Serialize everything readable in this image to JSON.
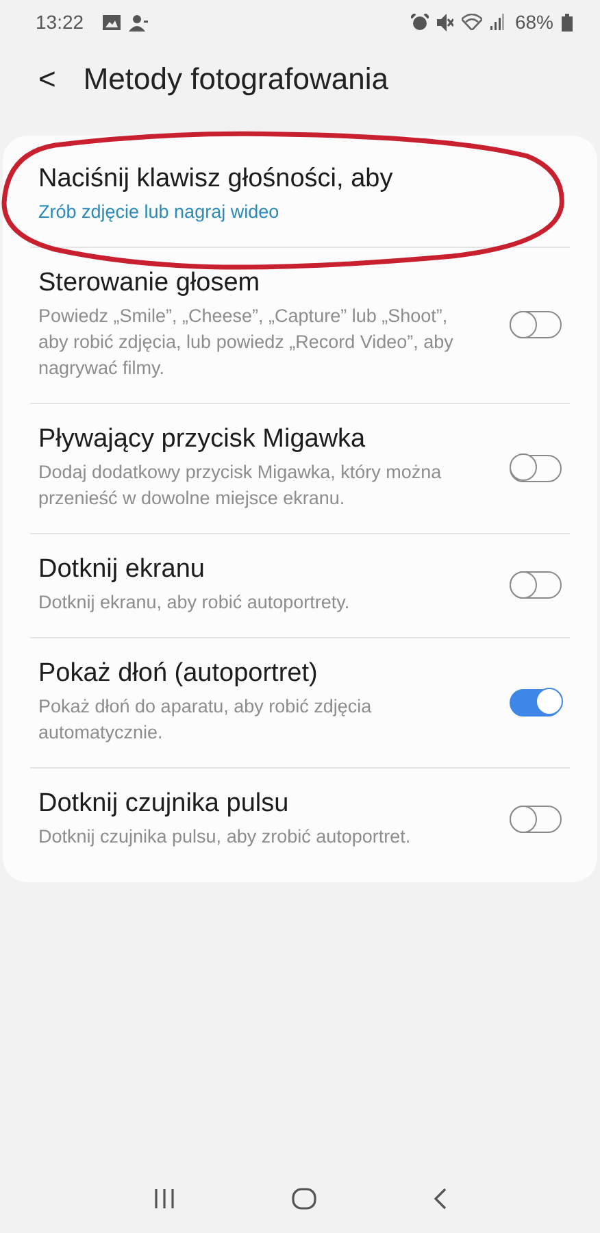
{
  "status_bar": {
    "time": "13:22",
    "battery_percent": "68%"
  },
  "header": {
    "back": "<",
    "title": "Metody fotografowania"
  },
  "settings": [
    {
      "kind": "link",
      "title": "Naciśnij klawisz głośności, aby",
      "subtitle": "Zrób zdjęcie lub nagraj wideo"
    },
    {
      "kind": "toggle",
      "title": "Sterowanie głosem",
      "subtitle": "Powiedz „Smile”, „Cheese”, „Capture” lub „Shoot”, aby robić zdjęcia, lub powiedz „Record Video”, aby nagrywać filmy.",
      "on": false
    },
    {
      "kind": "toggle",
      "title": "Pływający przycisk Migawka",
      "subtitle": "Dodaj dodatkowy przycisk Migawka, który można przenieść w dowolne miejsce ekranu.",
      "on": false
    },
    {
      "kind": "toggle",
      "title": "Dotknij ekranu",
      "subtitle": "Dotknij ekranu, aby robić autoportrety.",
      "on": false
    },
    {
      "kind": "toggle",
      "title": "Pokaż dłoń (autoportret)",
      "subtitle": "Pokaż dłoń do aparatu, aby robić zdjęcia automatycznie.",
      "on": true
    },
    {
      "kind": "toggle",
      "title": "Dotknij czujnika pulsu",
      "subtitle": "Dotknij czujnika pulsu, aby zrobić autoportret.",
      "on": false
    }
  ]
}
